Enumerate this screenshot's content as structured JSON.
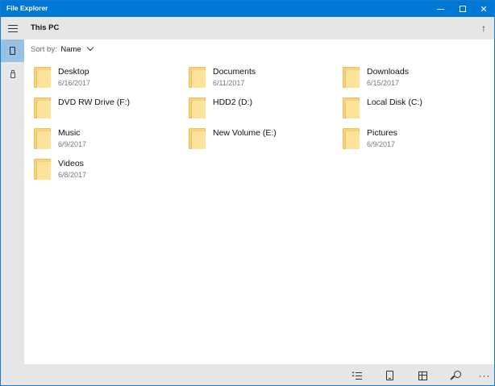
{
  "window": {
    "title": "File Explorer",
    "accent_color": "#0078d7",
    "controls": {
      "minimize_icon": "minimize-icon",
      "maximize_icon": "maximize-icon",
      "close_glyph": "✕"
    }
  },
  "rail": {
    "items": [
      {
        "icon": "hamburger-menu-icon",
        "selected": false
      },
      {
        "icon": "this-pc-icon",
        "selected": true
      },
      {
        "icon": "usb-drive-icon",
        "selected": false
      }
    ],
    "selected_color": "#98c1e6"
  },
  "header": {
    "title": "This PC",
    "up_glyph": "↑"
  },
  "sort": {
    "label": "Sort by:",
    "value": "Name"
  },
  "items": [
    {
      "name": "Desktop",
      "date": "6/16/2017"
    },
    {
      "name": "Documents",
      "date": "6/11/2017"
    },
    {
      "name": "Downloads",
      "date": "6/15/2017"
    },
    {
      "name": "DVD RW Drive (F:)",
      "date": ""
    },
    {
      "name": "HDD2 (D:)",
      "date": ""
    },
    {
      "name": "Local Disk (C:)",
      "date": ""
    },
    {
      "name": "Music",
      "date": "6/9/2017"
    },
    {
      "name": "New Volume (E:)",
      "date": ""
    },
    {
      "name": "Pictures",
      "date": "6/9/2017"
    },
    {
      "name": "Videos",
      "date": "6/8/2017"
    }
  ],
  "folder_colors": {
    "back": "#f6d37b",
    "front": "#fde39a"
  },
  "bottombar": {
    "buttons": [
      "select-list-icon",
      "preview-pane-icon",
      "grid-view-icon",
      "search-icon",
      "more-icon"
    ],
    "more_glyph": "···"
  }
}
